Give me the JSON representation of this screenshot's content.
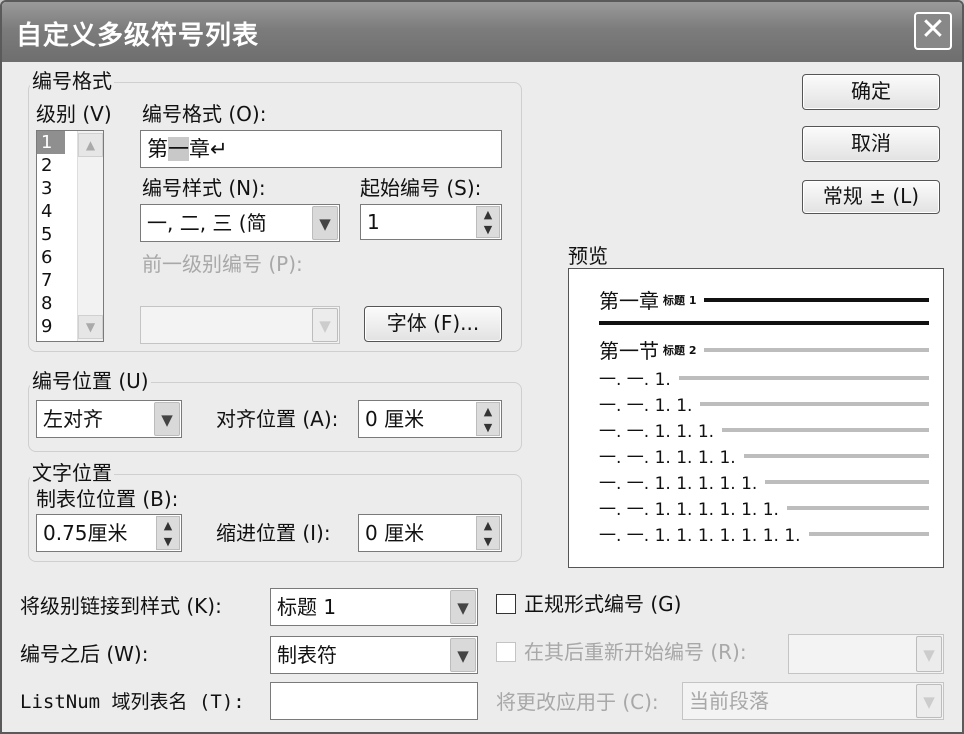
{
  "window": {
    "title": "自定义多级符号列表",
    "close_symbol": "✕"
  },
  "number_format_group": {
    "title": "编号格式",
    "level_label": "级别 (V)",
    "levels": [
      "1",
      "2",
      "3",
      "4",
      "5",
      "6",
      "7",
      "8",
      "9"
    ],
    "selected_level": "1",
    "format_label": "编号格式 (O):",
    "format_before": "第",
    "format_highlight": "一",
    "format_after": "章↵",
    "style_label": "编号样式 (N):",
    "style_value": "一, 二, 三 (简",
    "start_label": "起始编号 (S):",
    "start_value": "1",
    "prev_level_label": "前一级别编号 (P):",
    "prev_level_value": "",
    "font_button": "字体 (F)..."
  },
  "number_position_group": {
    "title": "编号位置 (U)",
    "align_value": "左对齐",
    "align_at_label": "对齐位置 (A):",
    "align_at_value": "0 厘米"
  },
  "text_position_group": {
    "title": "文字位置",
    "tab_label": "制表位位置 (B):",
    "tab_value": "0.75厘米",
    "indent_label": "缩进位置 (I):",
    "indent_value": "0 厘米"
  },
  "buttons": {
    "ok": "确定",
    "cancel": "取消",
    "more": "常规 ± (L)"
  },
  "preview": {
    "title": "预览",
    "lines": [
      {
        "text": "第一章",
        "tag": "标题 1"
      },
      {
        "text": "第一节",
        "tag": "标题 2"
      },
      {
        "text": "一. 一. 1."
      },
      {
        "text": "一. 一. 1. 1."
      },
      {
        "text": "一. 一. 1. 1. 1."
      },
      {
        "text": "一. 一. 1. 1. 1. 1."
      },
      {
        "text": "一. 一. 1. 1. 1. 1. 1."
      },
      {
        "text": "一. 一. 1. 1. 1. 1. 1. 1."
      },
      {
        "text": "一. 一. 1. 1. 1. 1. 1. 1. 1."
      }
    ]
  },
  "bottom": {
    "link_style_label": "将级别链接到样式 (K):",
    "link_style_value": "标题 1",
    "legal_label": "正规形式编号 (G)",
    "legal_checked": false,
    "follow_label": "编号之后 (W):",
    "follow_value": "制表符",
    "restart_label": "在其后重新开始编号 (R):",
    "restart_value": "",
    "listnum_label": "ListNum 域列表名 (T):",
    "listnum_value": "",
    "apply_label": "将更改应用于 (C):",
    "apply_value": "当前段落"
  },
  "colors": {
    "titlebar": "#7c7c7c",
    "dialog": "#ececec",
    "highlight": "#8f8f8f"
  }
}
